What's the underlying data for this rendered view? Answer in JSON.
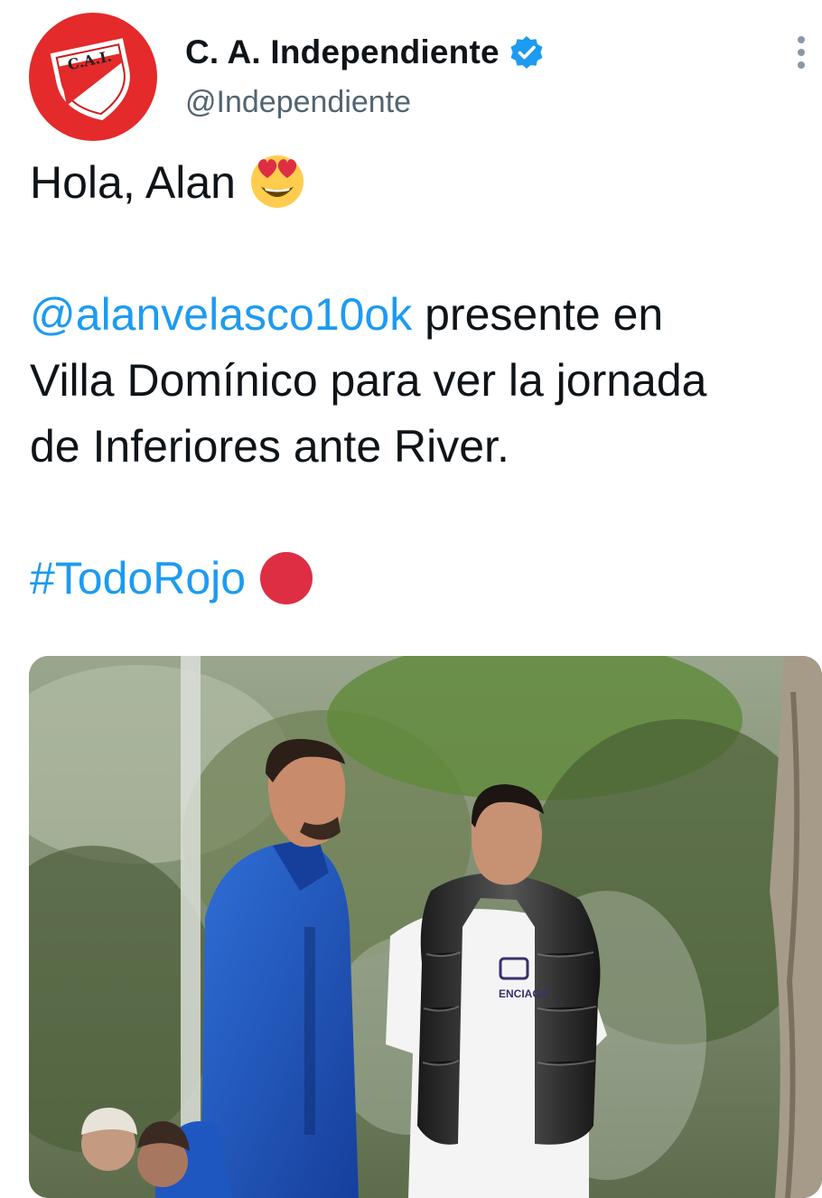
{
  "account": {
    "display_name": "C. A. Independiente",
    "handle": "@Independiente",
    "verified": true,
    "avatar_icon": "club-crest-icon",
    "avatar_crest_text": "C.A.I.",
    "avatar_color": "#e42a2a"
  },
  "tweet": {
    "line1": "Hola, Alan",
    "line1_emoji": "smiling-face-with-heart-eyes-emoji",
    "mention": "@alanvelasco10ok",
    "line2_rest": " presente en",
    "line3": "Villa Domínico para ver la jornada",
    "line4": "de Inferiores ante River.",
    "hashtag": "#TodoRojo",
    "hashtag_emoji": "red-circle-emoji"
  },
  "media": {
    "type": "photo",
    "shirt_text": "ENCIAGA"
  },
  "colors": {
    "link": "#1d9bf0",
    "verified": "#1d9bf0",
    "red_circle": "#dd2e44",
    "text_primary": "#0f1419",
    "text_secondary": "#536471"
  }
}
